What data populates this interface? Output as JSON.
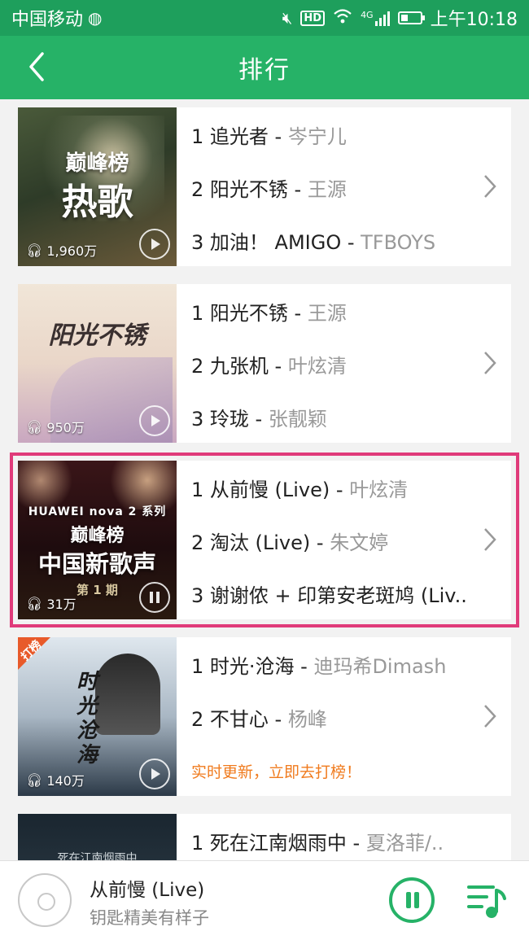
{
  "statusbar": {
    "carrier": "中国移动",
    "time": "上午10:18",
    "hd": "HD",
    "network": "4G"
  },
  "header": {
    "title": "排行"
  },
  "cards": [
    {
      "cover": {
        "line1": "巅峰榜",
        "line2": "热歌",
        "plays": "1,960万"
      },
      "songs": [
        {
          "title": "1 追光者",
          "artist": "岑宁儿"
        },
        {
          "title": "2 阳光不锈",
          "artist": "王源"
        },
        {
          "title": "3 加油！ AMIGO",
          "artist": "TFBOYS"
        }
      ]
    },
    {
      "cover": {
        "line1": "阳光不锈",
        "line2": "",
        "plays": "950万"
      },
      "songs": [
        {
          "title": "1 阳光不锈",
          "artist": "王源"
        },
        {
          "title": "2 九张机",
          "artist": "叶炫清"
        },
        {
          "title": "3 玲珑",
          "artist": "张靓颖"
        }
      ]
    },
    {
      "cover": {
        "brand": "HUAWEI nova 2 系列",
        "line1": "巅峰榜",
        "line2": "中国新歌声",
        "line3": "第 1 期",
        "plays": "31万"
      },
      "songs": [
        {
          "title": "1 从前慢 (Live)",
          "artist": "叶炫清"
        },
        {
          "title": "2 淘汰 (Live)",
          "artist": "朱文婷"
        },
        {
          "title": "3 谢谢侬 + 印第安老斑鸠 (Liv..",
          "artist": ""
        }
      ]
    },
    {
      "cover": {
        "badge": "打榜",
        "line1": "时光沧海",
        "plays": "140万"
      },
      "songs": [
        {
          "title": "1 时光·沧海",
          "artist": "迪玛希Dimash"
        },
        {
          "title": "2 不甘心",
          "artist": "杨峰"
        }
      ],
      "promo": "实时更新，立即去打榜！"
    },
    {
      "cover": {
        "line1": "死在江南烟雨中",
        "plays": ""
      },
      "songs": [
        {
          "title": "1 死在江南烟雨中",
          "artist": "夏洛菲/.."
        }
      ]
    }
  ],
  "player": {
    "title": "从前慢 (Live)",
    "subtitle": "钥匙精美有样子"
  },
  "colors": {
    "primary": "#26b267",
    "statusbar": "#1e9f5c",
    "highlight": "#e03b7a",
    "promo": "#f07b1e"
  }
}
